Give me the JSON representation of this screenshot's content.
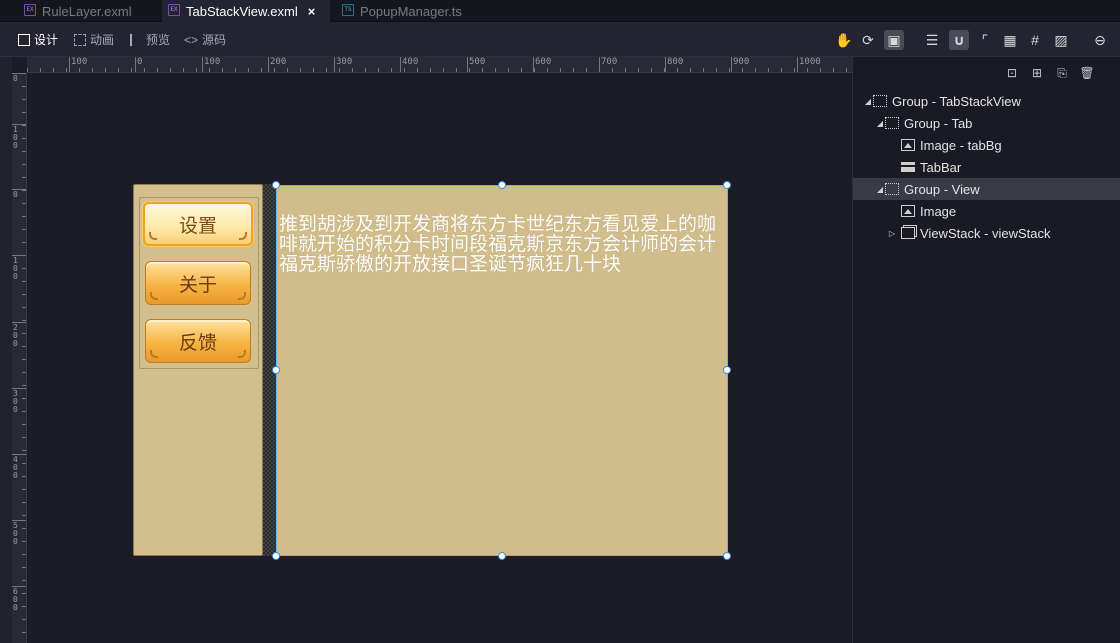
{
  "file_tabs": [
    {
      "name": "RuleLayer.exml",
      "icon": "exml-file-icon",
      "active": false
    },
    {
      "name": "TabStackView.exml",
      "icon": "exml-file-icon",
      "active": true,
      "close": "×"
    },
    {
      "name": "PopupManager.ts",
      "icon": "ts-file-icon",
      "active": false
    }
  ],
  "file_icon_text": {
    "exml": "EX",
    "ts": "TS"
  },
  "modes": {
    "design": "设计",
    "animation": "动画",
    "preview": "预览",
    "source": "源码",
    "source_prefix": "<>"
  },
  "toolbar_icons": [
    "hand-icon",
    "refresh-icon",
    "frame-icon",
    "layers-icon",
    "magnet-icon",
    "snap-icon",
    "grid-icon",
    "hash-icon",
    "image-toggle-icon",
    "zoom-out-icon"
  ],
  "ruler": {
    "h_labels": [
      "100",
      "0",
      "100",
      "200",
      "300",
      "400",
      "500",
      "600",
      "700",
      "800",
      "900",
      "1000"
    ],
    "v_labels": [
      "0",
      "100",
      "0",
      "100",
      "200",
      "300",
      "400",
      "500",
      "600"
    ]
  },
  "stage": {
    "tabs": [
      {
        "label": "设置",
        "selected": true
      },
      {
        "label": "关于",
        "selected": false
      },
      {
        "label": "反馈",
        "selected": false
      }
    ],
    "view_text": "推到胡涉及到开发商将东方卡世纪东方看见爱上的咖啡就开始的积分卡时间段福克斯京东方会计师的会计福克斯骄傲的开放接口圣诞节疯狂几十块"
  },
  "colors": {
    "panel_bg": "#d3bf8e",
    "selection_border": "#6cb7e8",
    "button_orange": "#f6b445"
  },
  "panel_tools": [
    "align-icon",
    "add-node-icon",
    "copy-icon",
    "delete-icon"
  ],
  "tree": [
    {
      "label": "Group - TabStackView",
      "depth": 0,
      "expanded": true,
      "icon": "group-icon",
      "selected": false
    },
    {
      "label": "Group - Tab",
      "depth": 1,
      "expanded": true,
      "icon": "group-icon",
      "selected": false
    },
    {
      "label": "Image - tabBg",
      "depth": 2,
      "expanded": null,
      "icon": "image-icon",
      "selected": false
    },
    {
      "label": "TabBar",
      "depth": 2,
      "expanded": null,
      "icon": "tabbar-icon",
      "selected": false
    },
    {
      "label": "Group - View",
      "depth": 1,
      "expanded": true,
      "icon": "group-icon",
      "selected": true
    },
    {
      "label": "Image",
      "depth": 2,
      "expanded": null,
      "icon": "image-icon",
      "selected": false
    },
    {
      "label": "ViewStack - viewStack",
      "depth": 2,
      "expanded": false,
      "icon": "viewstack-icon",
      "selected": false
    }
  ]
}
